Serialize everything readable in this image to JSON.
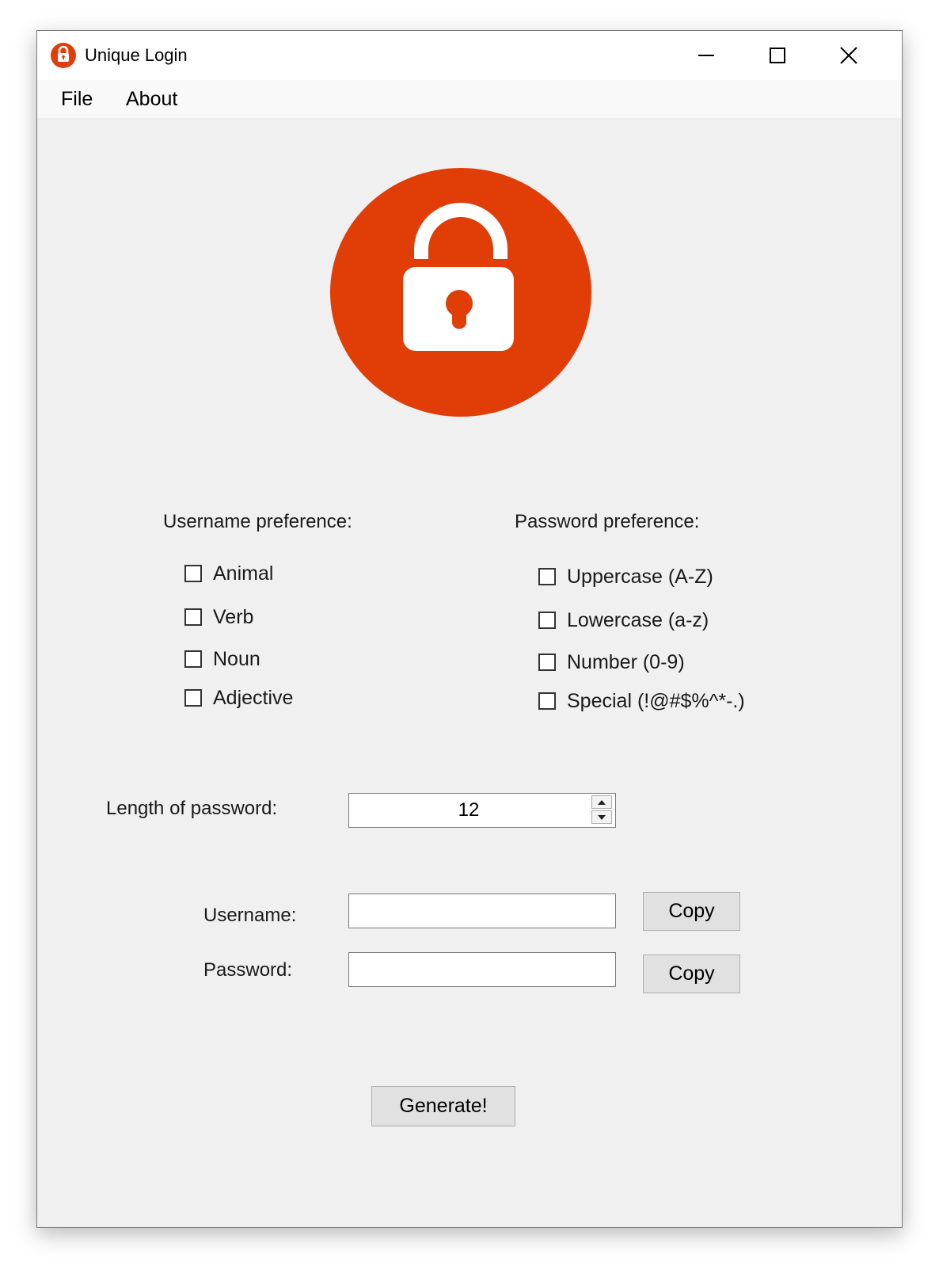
{
  "window": {
    "title": "Unique Login",
    "accent_color": "#e03e06",
    "icons": [
      "padlock-icon",
      "minimize-icon",
      "maximize-icon",
      "close-icon"
    ]
  },
  "menu": {
    "items": [
      {
        "label": "File"
      },
      {
        "label": "About"
      }
    ]
  },
  "username_pref": {
    "label": "Username preference:",
    "options": [
      {
        "label": "Animal",
        "checked": false
      },
      {
        "label": "Verb",
        "checked": false
      },
      {
        "label": "Noun",
        "checked": false
      },
      {
        "label": "Adjective",
        "checked": false
      }
    ]
  },
  "password_pref": {
    "label": "Password preference:",
    "options": [
      {
        "label": "Uppercase (A-Z)",
        "checked": false
      },
      {
        "label": "Lowercase (a-z)",
        "checked": false
      },
      {
        "label": "Number (0-9)",
        "checked": false
      },
      {
        "label": "Special (!@#$%^*-.)",
        "checked": false
      }
    ]
  },
  "length": {
    "label": "Length of password:",
    "value": "12"
  },
  "output": {
    "username_label": "Username:",
    "username_value": "",
    "password_label": "Password:",
    "password_value": "",
    "copy_label": "Copy"
  },
  "generate_label": "Generate!"
}
